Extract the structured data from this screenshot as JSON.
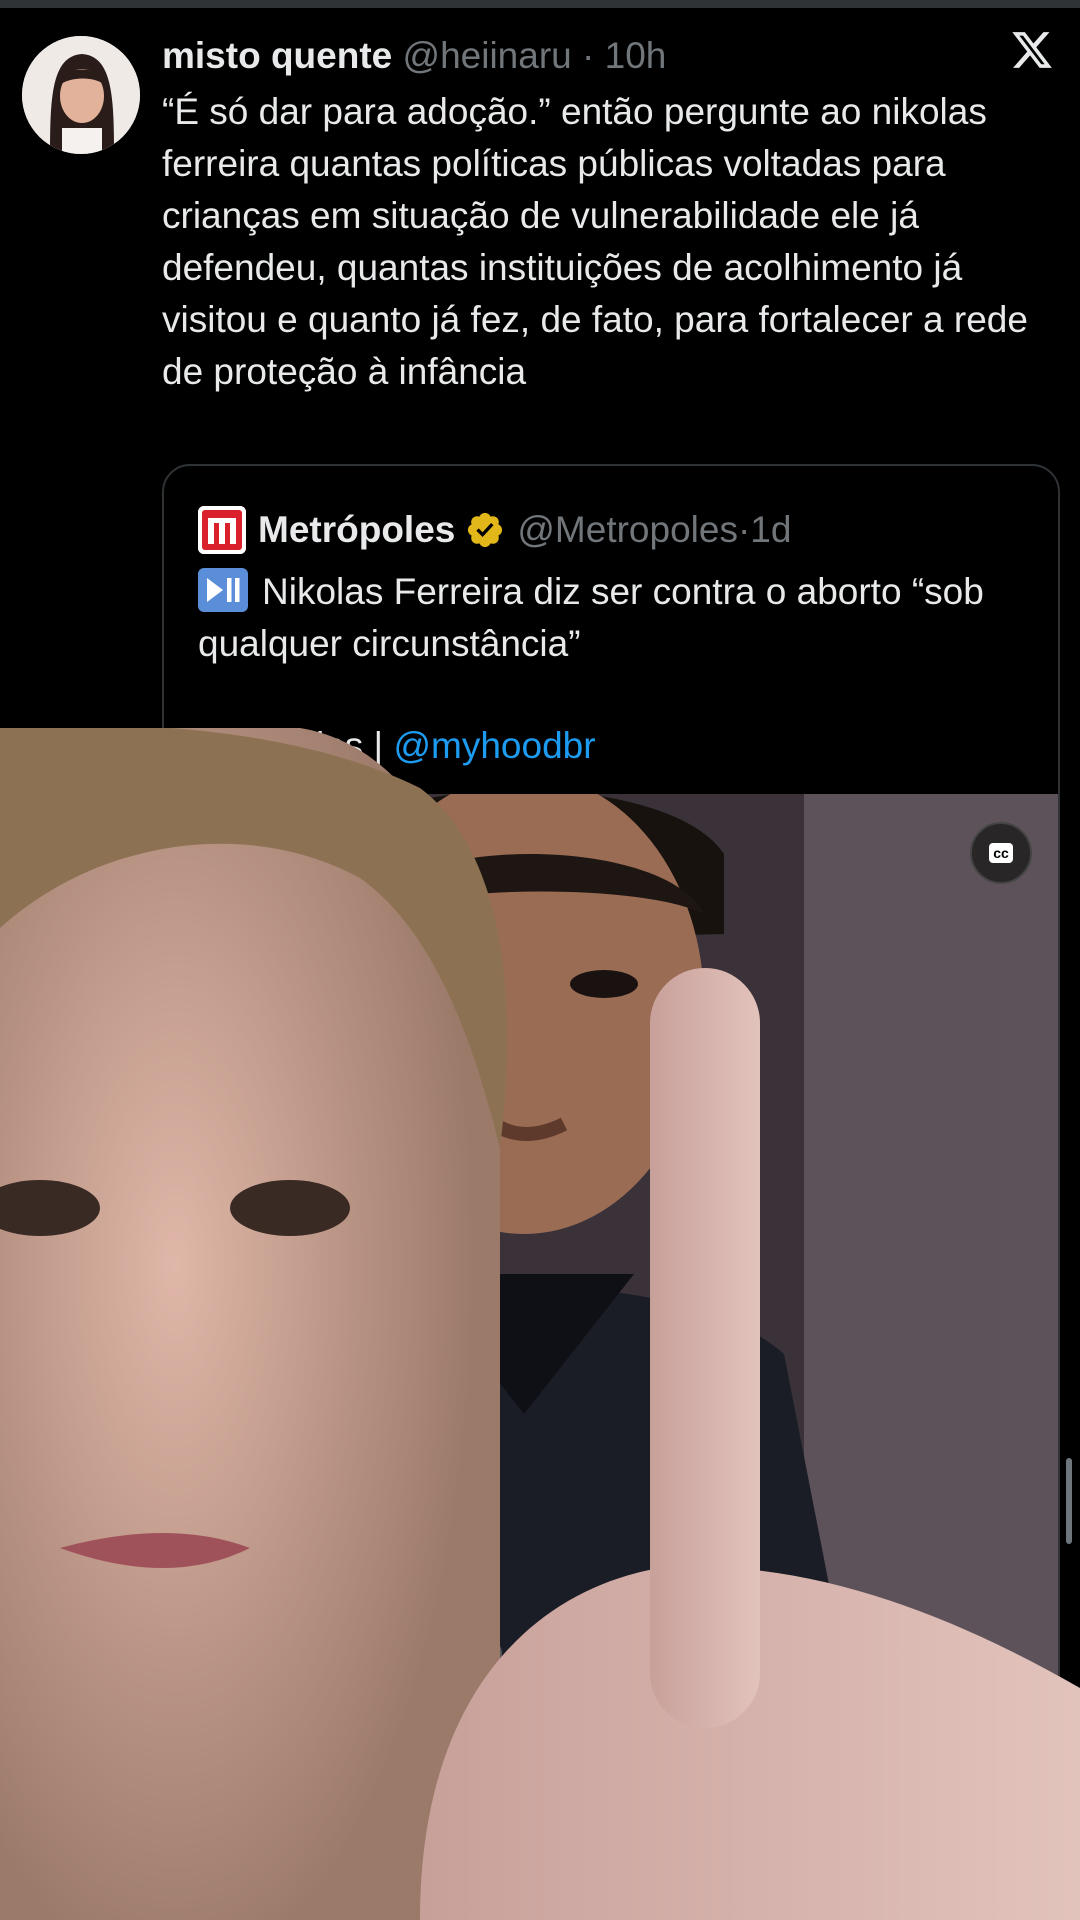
{
  "tweet": {
    "author_name": "misto quente",
    "author_handle": "@heiinaru",
    "separator": "·",
    "time": "10h",
    "text": "“É só dar para adoção.” então pergunte ao nikolas ferreira quantas políticas públicas voltadas para crianças em situação de vulnerabilidade ele já defendeu, quantas instituições de acolhimento já visitou e quanto já fez, de fato, para fortalecer a rede de proteção à infância"
  },
  "quoted_tweet": {
    "author_name": "Metrópoles",
    "author_handle": "@Metropoles",
    "separator": "·",
    "time": "1d",
    "text": "Nikolas Ferreira diz ser contra o aborto “sob qualquer circunstância”",
    "credit_name": "leodias",
    "credit_separator": "|",
    "credit_link": "@myhoodbr",
    "video": {
      "cc_label": "cc"
    }
  },
  "icons": {
    "x_logo": "x-logo-icon",
    "verified": "verified-badge-icon",
    "play_pause": "play-pause-icon",
    "microphone": "microphone-icon",
    "brand": "metropoles-logo-icon"
  },
  "colors": {
    "background": "#000000",
    "text": "#e7e9ea",
    "muted": "#71767b",
    "link": "#1d9bf0",
    "border": "#2f3336",
    "verified_gold": "#e2b719",
    "brand_red": "#d9202b"
  }
}
